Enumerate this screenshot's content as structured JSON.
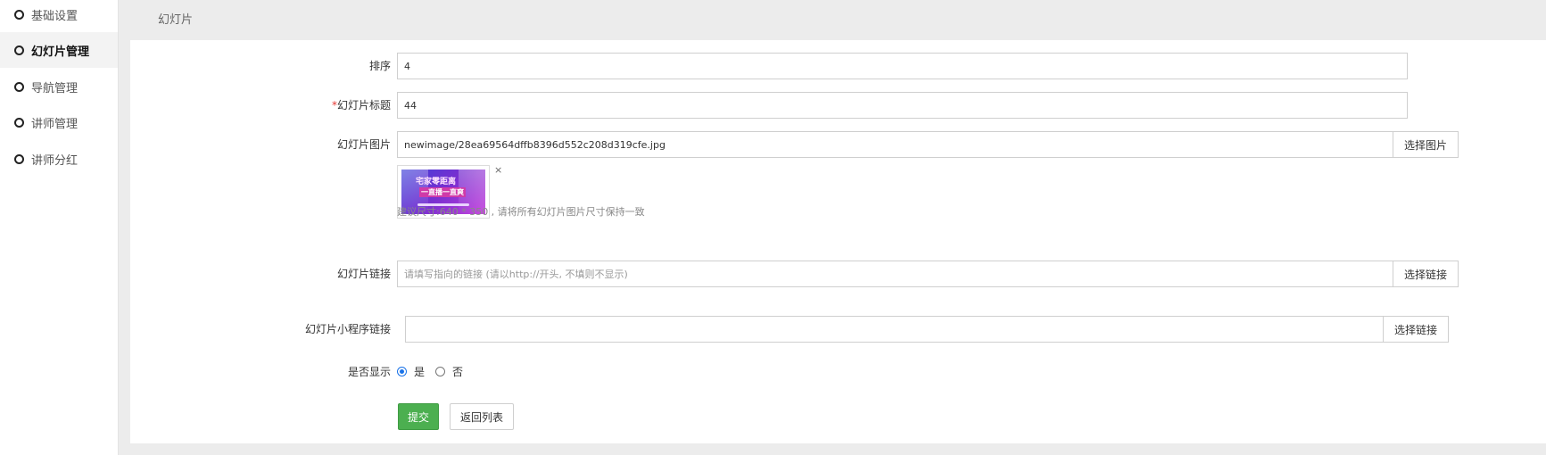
{
  "sidebar": {
    "items": [
      {
        "label": "基础设置",
        "active": false
      },
      {
        "label": "幻灯片管理",
        "active": true
      },
      {
        "label": "导航管理",
        "active": false
      },
      {
        "label": "讲师管理",
        "active": false
      },
      {
        "label": "讲师分红",
        "active": false
      }
    ]
  },
  "header": {
    "title": "幻灯片"
  },
  "form": {
    "sort": {
      "label": "排序",
      "value": "4"
    },
    "title": {
      "required_mark": "*",
      "label": "幻灯片标题",
      "value": "44"
    },
    "image": {
      "label": "幻灯片图片",
      "value": "newimage/28ea69564dffb8396d552c208d319cfe.jpg",
      "button": "选择图片",
      "remove": "×",
      "thumb_text_1": "宅家零距离",
      "thumb_text_2": "一直播一直爽",
      "hint": "建议尺寸:640 * 350 , 请将所有幻灯片图片尺寸保持一致"
    },
    "link": {
      "label": "幻灯片链接",
      "placeholder": "请填写指向的链接 (请以http://开头, 不填则不显示)",
      "button": "选择链接"
    },
    "mini_link": {
      "label": "幻灯片小程序链接",
      "value": "",
      "button": "选择链接"
    },
    "display": {
      "label": "是否显示",
      "options": [
        {
          "label": "是",
          "checked": true
        },
        {
          "label": "否",
          "checked": false
        }
      ]
    },
    "submit": "提交",
    "back": "返回列表"
  },
  "colors": {
    "accent_green": "#4caf50",
    "radio_blue": "#1a73e8",
    "required_red": "#e53935",
    "background": "#ececec"
  }
}
